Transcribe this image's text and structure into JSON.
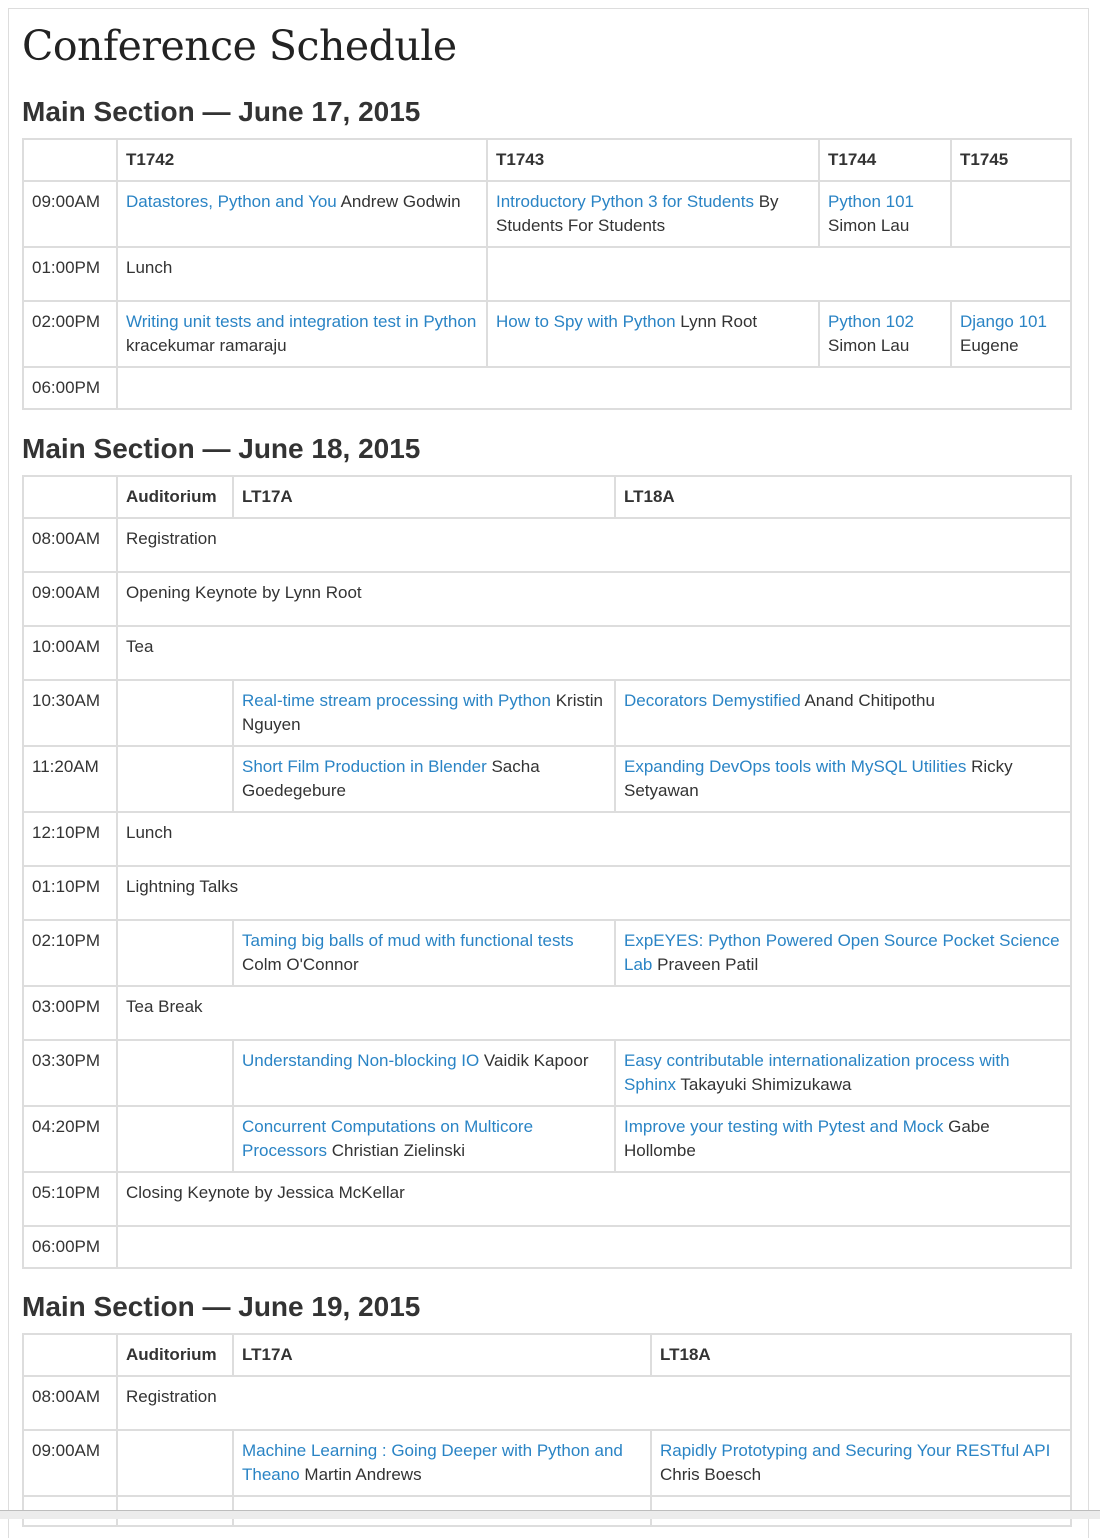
{
  "title": "Conference Schedule",
  "day1": {
    "heading": "Main Section — June 17, 2015",
    "rooms": [
      "T1742",
      "T1743",
      "T1744",
      "T1745"
    ],
    "r1": {
      "time": "09:00AM",
      "c1": {
        "talk": "Datastores, Python and You",
        "speaker": "Andrew Godwin"
      },
      "c2": {
        "talk": "Introductory Python 3 for Students",
        "speaker": "By Students For Students"
      },
      "c3": {
        "talk": "Python 101",
        "speaker": "Simon Lau"
      }
    },
    "r2": {
      "time": "01:00PM",
      "event": "Lunch"
    },
    "r3": {
      "time": "02:00PM",
      "c1": {
        "talk": "Writing unit tests and integration test in Python",
        "speaker": "kracekumar ramaraju"
      },
      "c2": {
        "talk": "How to Spy with Python",
        "speaker": "Lynn Root"
      },
      "c3": {
        "talk": "Python 102",
        "speaker": "Simon Lau"
      },
      "c4": {
        "talk": "Django 101",
        "speaker": "Eugene"
      }
    },
    "r4": {
      "time": "06:00PM"
    }
  },
  "day2": {
    "heading": "Main Section — June 18, 2015",
    "rooms": [
      "Auditorium",
      "LT17A",
      "LT18A"
    ],
    "r1": {
      "time": "08:00AM",
      "event": "Registration"
    },
    "r2": {
      "time": "09:00AM",
      "event": "Opening Keynote by Lynn Root"
    },
    "r3": {
      "time": "10:00AM",
      "event": "Tea"
    },
    "r4": {
      "time": "10:30AM",
      "c2": {
        "talk": "Real-time stream processing with Python",
        "speaker": "Kristin Nguyen"
      },
      "c3": {
        "talk": "Decorators Demystified",
        "speaker": "Anand Chitipothu"
      }
    },
    "r5": {
      "time": "11:20AM",
      "c2": {
        "talk": "Short Film Production in Blender",
        "speaker": "Sacha Goedegebure"
      },
      "c3": {
        "talk": "Expanding DevOps tools with MySQL Utilities",
        "speaker": "Ricky Setyawan"
      }
    },
    "r6": {
      "time": "12:10PM",
      "event": "Lunch"
    },
    "r7": {
      "time": "01:10PM",
      "event": "Lightning Talks"
    },
    "r8": {
      "time": "02:10PM",
      "c2": {
        "talk": "Taming big balls of mud with functional tests",
        "speaker": "Colm O'Connor"
      },
      "c3": {
        "talk": "ExpEYES: Python Powered Open Source Pocket Science Lab",
        "speaker": "Praveen Patil"
      }
    },
    "r9": {
      "time": "03:00PM",
      "event": "Tea Break"
    },
    "r10": {
      "time": "03:30PM",
      "c2": {
        "talk": "Understanding Non-blocking IO",
        "speaker": "Vaidik Kapoor"
      },
      "c3": {
        "talk": "Easy contributable internationalization process with Sphinx",
        "speaker": "Takayuki Shimizukawa"
      }
    },
    "r11": {
      "time": "04:20PM",
      "c2": {
        "talk": "Concurrent Computations on Multicore Processors",
        "speaker": "Christian Zielinski"
      },
      "c3": {
        "talk": "Improve your testing with Pytest and Mock",
        "speaker": "Gabe Hollombe"
      }
    },
    "r12": {
      "time": "05:10PM",
      "event": "Closing Keynote by Jessica McKellar"
    },
    "r13": {
      "time": "06:00PM"
    }
  },
  "day3": {
    "heading": "Main Section — June 19, 2015",
    "rooms": [
      "Auditorium",
      "LT17A",
      "LT18A"
    ],
    "r1": {
      "time": "08:00AM",
      "event": "Registration"
    },
    "r2": {
      "time": "09:00AM",
      "c2": {
        "talk": "Machine Learning : Going Deeper with Python and Theano",
        "speaker": "Martin Andrews"
      },
      "c3": {
        "talk": "Rapidly Prototyping and Securing Your RESTful API",
        "speaker": "Chris Boesch"
      }
    }
  },
  "colors": {
    "link": "#2a84c5",
    "text": "#333333",
    "border": "#dddddd"
  }
}
